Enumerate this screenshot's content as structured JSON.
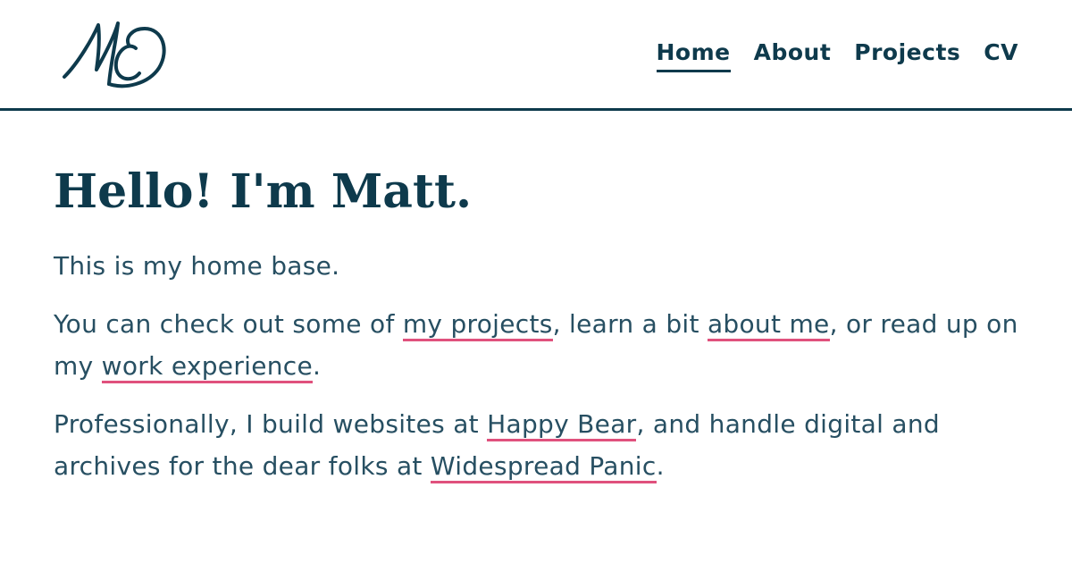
{
  "header": {
    "logo_text": "MC",
    "nav": [
      {
        "label": "Home",
        "active": true
      },
      {
        "label": "About",
        "active": false
      },
      {
        "label": "Projects",
        "active": false
      },
      {
        "label": "CV",
        "active": false
      }
    ]
  },
  "main": {
    "heading": "Hello! I'm Matt.",
    "paragraph1": "This is my home base.",
    "paragraph2": {
      "text1": "You can check out some of ",
      "link1": "my projects",
      "text2": ", learn a bit ",
      "link2": "about me",
      "text3": ", or read up on my ",
      "link3": "work experience",
      "text4": "."
    },
    "paragraph3": {
      "text1": "Professionally, I build websites at ",
      "link1": "Happy Bear",
      "text2": ", and handle digital and archives for the dear folks at ",
      "link2": "Widespread Panic",
      "text3": "."
    }
  },
  "colors": {
    "primary": "#0e3a4c",
    "body_text": "#274f62",
    "link_underline": "#e0517d",
    "background": "#ffffff"
  }
}
